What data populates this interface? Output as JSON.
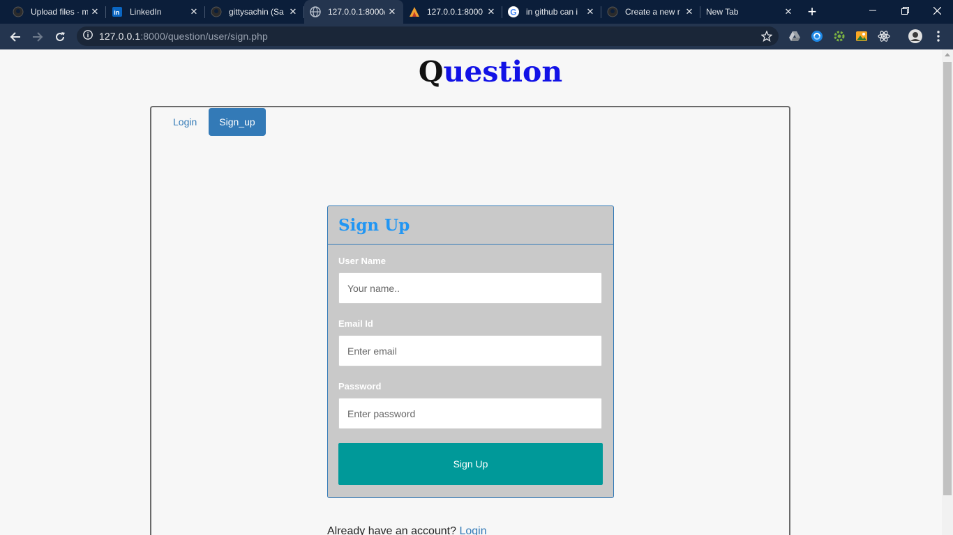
{
  "browser": {
    "tabs": [
      {
        "title": "Upload files · m",
        "icon": "github-icon"
      },
      {
        "title": "LinkedIn",
        "icon": "linkedin-icon"
      },
      {
        "title": "gittysachin (Sa",
        "icon": "github-icon"
      },
      {
        "title": "127.0.0.1:8000/",
        "icon": "globe-icon",
        "active": true
      },
      {
        "title": "127.0.0.1:8000",
        "icon": "site-logo-icon"
      },
      {
        "title": "in github can i",
        "icon": "google-icon"
      },
      {
        "title": "Create a new r",
        "icon": "github-icon"
      },
      {
        "title": "New Tab",
        "icon": "none"
      }
    ],
    "url_host": "127.0.0.1",
    "url_rest": ":8000/question/user/sign.php"
  },
  "page": {
    "brand_first": "Q",
    "brand_rest": "uestion",
    "nav_tabs": [
      {
        "label": "Login",
        "active": false
      },
      {
        "label": "Sign_up",
        "active": true
      }
    ],
    "signup_card": {
      "title": "Sign Up",
      "username_label": "User Name",
      "username_placeholder": "Your name..",
      "email_label": "Email Id",
      "email_placeholder": "Enter email",
      "password_label": "Password",
      "password_placeholder": "Enter password",
      "submit_label": "Sign Up"
    },
    "footer": {
      "text": "Already have an account?",
      "link": "Login"
    }
  },
  "colors": {
    "brand_blue": "#1212e6",
    "accent": "#337ab7",
    "card_title": "#2196f3",
    "submit": "#009999",
    "chrome_dark": "#0b1e3a"
  }
}
